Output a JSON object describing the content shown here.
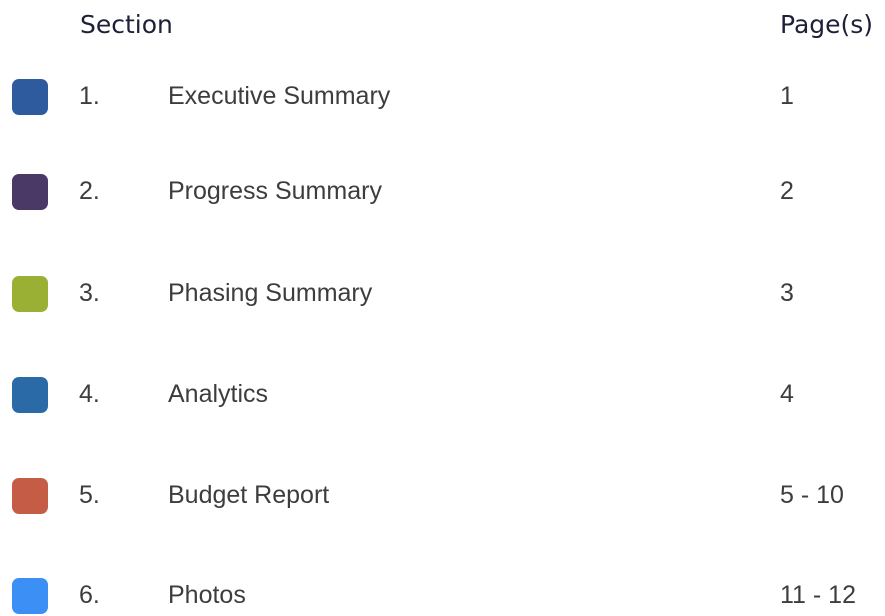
{
  "header": {
    "section_label": "Section",
    "pages_label": "Page(s)"
  },
  "rows": [
    {
      "number": "1.",
      "title": "Executive Summary",
      "pages": "1",
      "color": "#2e5a9e"
    },
    {
      "number": "2.",
      "title": "Progress Summary",
      "pages": "2",
      "color": "#4a3866"
    },
    {
      "number": "3.",
      "title": "Phasing Summary",
      "pages": "3",
      "color": "#99b035"
    },
    {
      "number": "4.",
      "title": "Analytics",
      "pages": "4",
      "color": "#2a6aa6"
    },
    {
      "number": "5.",
      "title": "Budget Report",
      "pages": "5 - 10",
      "color": "#c45c46"
    },
    {
      "number": "6.",
      "title": "Photos",
      "pages": "11 - 12",
      "color": "#3b8ff5"
    }
  ]
}
